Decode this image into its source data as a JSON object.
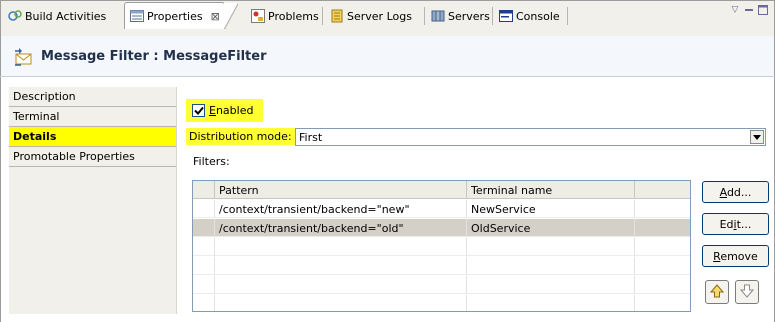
{
  "tabs": [
    {
      "label": "Build Activities",
      "icon": "build-activities-icon",
      "active": false
    },
    {
      "label": "Properties",
      "icon": "properties-icon",
      "active": true,
      "close": "⊠"
    },
    {
      "label": "Problems",
      "icon": "problems-icon",
      "active": false
    },
    {
      "label": "Server Logs",
      "icon": "server-logs-icon",
      "active": false
    },
    {
      "label": "Servers",
      "icon": "servers-icon",
      "active": false
    },
    {
      "label": "Console",
      "icon": "console-icon",
      "active": false
    }
  ],
  "header": {
    "title": "Message Filter : MessageFilter",
    "icon": "message-filter-icon"
  },
  "sidebar": {
    "items": [
      {
        "label": "Description"
      },
      {
        "label": "Terminal"
      },
      {
        "label": "Details",
        "selected": true
      },
      {
        "label": "Promotable Properties"
      }
    ]
  },
  "details": {
    "enabled_label_first": "E",
    "enabled_label_rest": "nabled",
    "enabled_checked": true,
    "distribution_label": "Distribution mode:",
    "distribution_value": "First",
    "filters_label": "Filters:"
  },
  "table": {
    "columns": [
      "Pattern",
      "Terminal name"
    ],
    "rows": [
      {
        "pattern": "/context/transient/backend=\"new\"",
        "terminal": "NewService"
      },
      {
        "pattern": "/context/transient/backend=\"old\"",
        "terminal": "OldService"
      }
    ]
  },
  "buttons": {
    "add_first": "A",
    "add_rest": "dd...",
    "edit_first": "Ed",
    "edit_u": "i",
    "edit_rest": "t...",
    "remove_first": "R",
    "remove_rest": "emove"
  },
  "colors": {
    "highlight": "#ffff00",
    "selected_row": "#d4d0c8",
    "tab_bar": "#f1f0ea"
  }
}
